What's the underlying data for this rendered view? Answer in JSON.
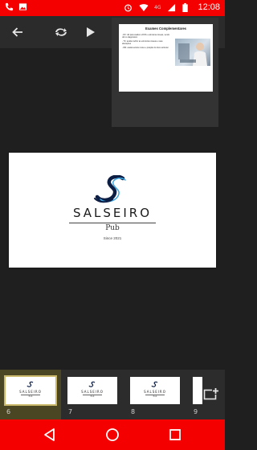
{
  "status_bar": {
    "time": "12:08",
    "network_label": "4G"
  },
  "toolbar": {
    "back": "arrow-left-icon",
    "swap": "swap-icon",
    "play": "play-icon"
  },
  "preview_slide": {
    "title": "Exames Complementares",
    "bullets": [
      "- RX: útil para avaliar a ATM e estruturas ósseas, sendo útil no diagnóstico",
      "- TC: avalia melhor as estruturas ósseas e suas alterações",
      "- RM: avalia tecidos moles e posição do disco articular"
    ]
  },
  "main_slide": {
    "logo_letter": "S",
    "brand": "SALSEIRO",
    "subtitle": "Pub",
    "since": "Since 2021"
  },
  "thumbnails": [
    {
      "number": "6",
      "brand": "SALSEIRO",
      "subtitle": "Pub"
    },
    {
      "number": "7",
      "brand": "SALSEIRO",
      "subtitle": "Pub"
    },
    {
      "number": "8",
      "brand": "SALSEIRO",
      "subtitle": "Pub"
    },
    {
      "number": "9"
    }
  ],
  "add_slide_icon": "add-slide-icon",
  "colors": {
    "status_bar": "#f40000",
    "nav_bar": "#f40000",
    "toolbar": "#2b2b2b",
    "canvas": "#1f1f1f",
    "selected_thumb": "#4a4623",
    "logo_navy": "#0d1e45",
    "logo_blue": "#3fa7e0"
  }
}
